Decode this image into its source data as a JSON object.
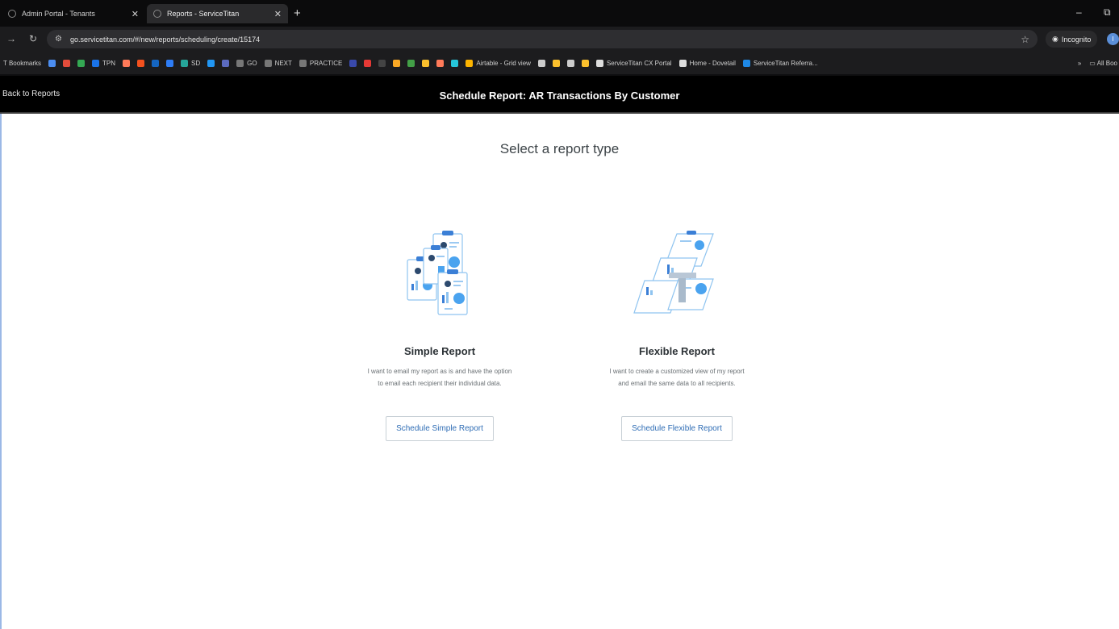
{
  "browser": {
    "tabs": [
      {
        "title": "Admin Portal - Tenants",
        "active": false
      },
      {
        "title": "Reports - ServiceTitan",
        "active": true
      }
    ],
    "new_tab": "+",
    "window_controls": [
      "–",
      "⧉"
    ],
    "url": "go.servicetitan.com/#/new/reports/scheduling/create/15174",
    "incognito_label": "Incognito",
    "profile_initial": "I",
    "bookmarks": [
      {
        "label": "T Bookmarks",
        "color": ""
      },
      {
        "label": "",
        "color": "#4b8df0"
      },
      {
        "label": "",
        "color": "#e24c3b"
      },
      {
        "label": "",
        "color": "#34a853"
      },
      {
        "label": "TPN",
        "color": "#1a73e8"
      },
      {
        "label": "",
        "color": "#ff7a59"
      },
      {
        "label": "",
        "color": "#f4511e"
      },
      {
        "label": "",
        "color": "#1565c0"
      },
      {
        "label": "",
        "color": "#2e7df6"
      },
      {
        "label": "SD",
        "color": "#26a69a"
      },
      {
        "label": "",
        "color": "#2196f3"
      },
      {
        "label": "",
        "color": "#5c6bc0"
      },
      {
        "label": "GO",
        "color": "#777777"
      },
      {
        "label": "NEXT",
        "color": "#777777"
      },
      {
        "label": "PRACTICE",
        "color": "#777777"
      },
      {
        "label": "",
        "color": "#3949ab"
      },
      {
        "label": "",
        "color": "#e53935"
      },
      {
        "label": "",
        "color": "#444444"
      },
      {
        "label": "",
        "color": "#f9a825"
      },
      {
        "label": "",
        "color": "#43a047"
      },
      {
        "label": "",
        "color": "#fbc02d"
      },
      {
        "label": "",
        "color": "#ff7a59"
      },
      {
        "label": "",
        "color": "#26c6da"
      },
      {
        "label": "Airtable - Grid view",
        "color": "#fcb400"
      },
      {
        "label": "",
        "color": "#cccccc"
      },
      {
        "label": "",
        "color": "#fbc02d"
      },
      {
        "label": "",
        "color": "#cccccc"
      },
      {
        "label": "",
        "color": "#fbc02d"
      },
      {
        "label": "ServiceTitan CX Portal",
        "color": "#dddddd"
      },
      {
        "label": "Home - Dovetail",
        "color": "#dddddd"
      },
      {
        "label": "ServiceTitan Referra...",
        "color": "#1e88e5"
      }
    ],
    "bookmarks_overflow": "»",
    "all_bookmarks": "All Boo"
  },
  "app": {
    "back_link": "Back to Reports",
    "title": "Schedule Report: AR Transactions By Customer"
  },
  "main": {
    "heading": "Select a report type",
    "cards": [
      {
        "title": "Simple Report",
        "description": "I want to email my report as is and have the option to email each recipient their individual data.",
        "button": "Schedule Simple Report"
      },
      {
        "title": "Flexible Report",
        "description": "I want to create a customized view of my report and email the same data to all recipients.",
        "button": "Schedule Flexible Report"
      }
    ]
  },
  "colors": {
    "accent": "#2f6db5",
    "header_bg": "#000000"
  }
}
